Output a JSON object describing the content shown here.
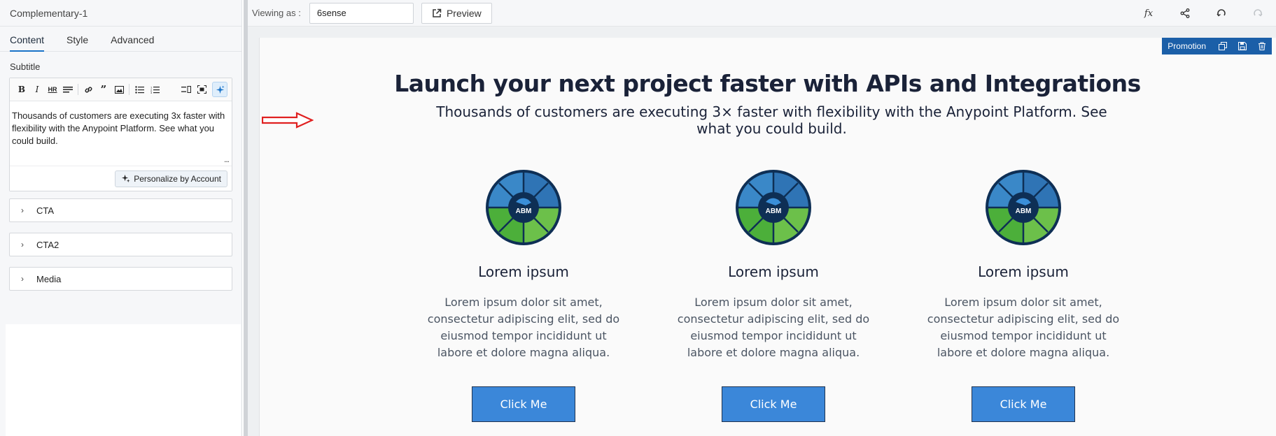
{
  "panel": {
    "title": "Complementary-1",
    "tabs": [
      {
        "label": "Content",
        "active": true
      },
      {
        "label": "Style",
        "active": false
      },
      {
        "label": "Advanced",
        "active": false
      }
    ],
    "subtitle_label": "Subtitle",
    "subtitle_text": "Thousands of customers are executing 3x faster with flexibility with the Anypoint Platform. See what you could build.",
    "more_indicator": "...",
    "personalize_label": "Personalize by Account",
    "sections": [
      {
        "label": "CTA"
      },
      {
        "label": "CTA2"
      },
      {
        "label": "Media"
      }
    ]
  },
  "toolbar": {
    "viewing_label": "Viewing as :",
    "viewing_value": "6sense",
    "preview_label": "Preview",
    "fx_label": "fx"
  },
  "canvas": {
    "promotion_label": "Promotion",
    "heading": "Launch your next project faster with APIs and Integrations",
    "subtitle": "Thousands of customers are executing 3× faster with flexibility with the Anypoint Platform. See what you could build.",
    "cards": [
      {
        "image_label": "ABM",
        "title": "Lorem ipsum",
        "text": "Lorem ipsum dolor sit amet, consectetur adipiscing elit, sed do eiusmod tempor incididunt ut labore et dolore magna aliqua.",
        "button": "Click Me"
      },
      {
        "image_label": "ABM",
        "title": "Lorem ipsum",
        "text": "Lorem ipsum dolor sit amet, consectetur adipiscing elit, sed do eiusmod tempor incididunt ut labore et dolore magna aliqua.",
        "button": "Click Me"
      },
      {
        "image_label": "ABM",
        "title": "Lorem ipsum",
        "text": "Lorem ipsum dolor sit amet, consectetur adipiscing elit, sed do eiusmod tempor incididunt ut labore et dolore magna aliqua.",
        "button": "Click Me"
      }
    ]
  },
  "colors": {
    "accent": "#1a73c8",
    "promotion_bar": "#1b5fa8",
    "button": "#3b87d9",
    "heading": "#1a2238",
    "arrow": "#e02020"
  },
  "icons": {
    "toolbar": [
      "bold-icon",
      "italic-icon",
      "heading-icon",
      "heading-alt-icon",
      "link-icon",
      "quote-icon",
      "image-icon",
      "bullet-list-icon",
      "numbered-list-icon",
      "source-icon",
      "fullscreen-icon",
      "ai-sparkle-icon"
    ],
    "top": [
      "fx-icon",
      "share-icon",
      "undo-icon",
      "redo-icon"
    ],
    "promotion": [
      "duplicate-icon",
      "save-icon",
      "delete-icon"
    ]
  }
}
